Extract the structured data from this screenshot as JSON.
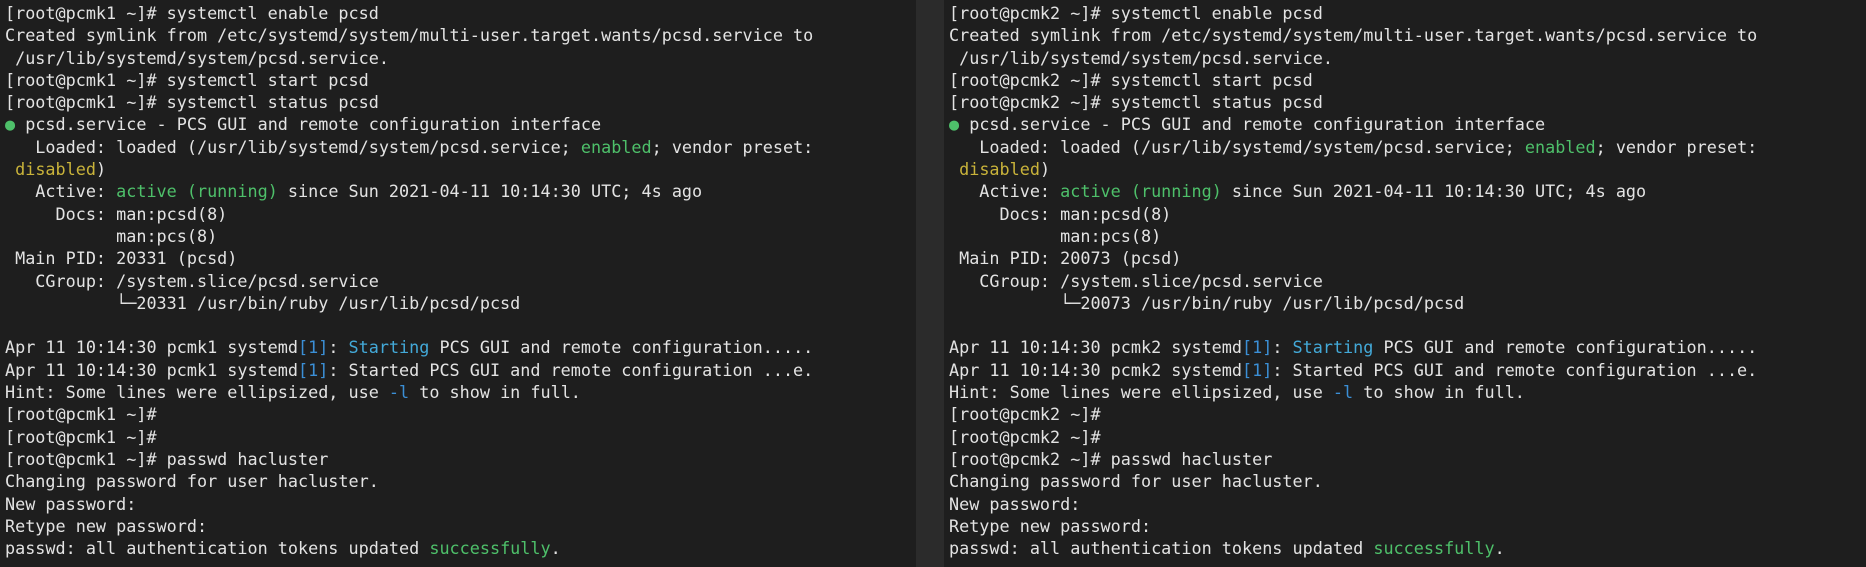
{
  "colors": {
    "background": "#1e1e1e",
    "text": "#e3e3e3",
    "green": "#4ec06a",
    "yellow": "#c9b33a",
    "blue": "#3b8fd6",
    "cyan": "#43a9d8"
  },
  "panes": [
    {
      "host": "pcmk1",
      "lines": [
        [
          {
            "t": "[root@pcmk1 ~]# systemctl enable pcsd"
          }
        ],
        [
          {
            "t": "Created symlink from /etc/systemd/system/multi-user.target.wants/pcsd.service to"
          }
        ],
        [
          {
            "t": " /usr/lib/systemd/system/pcsd.service."
          }
        ],
        [
          {
            "t": "[root@pcmk1 ~]# systemctl start pcsd"
          }
        ],
        [
          {
            "t": "[root@pcmk1 ~]# systemctl status pcsd"
          }
        ],
        [
          {
            "t": "●",
            "c": "dot"
          },
          {
            "t": " pcsd.service - PCS GUI and remote configuration interface"
          }
        ],
        [
          {
            "t": "   Loaded: loaded (/usr/lib/systemd/system/pcsd.service; "
          },
          {
            "t": "enabled",
            "c": "green"
          },
          {
            "t": "; vendor preset:"
          }
        ],
        [
          {
            "t": " "
          },
          {
            "t": "disabled",
            "c": "yellow"
          },
          {
            "t": ")"
          }
        ],
        [
          {
            "t": "   Active: "
          },
          {
            "t": "active (running)",
            "c": "green"
          },
          {
            "t": " since Sun 2021-04-11 10:14:30 UTC; 4s ago"
          }
        ],
        [
          {
            "t": "     Docs: man:pcsd(8)"
          }
        ],
        [
          {
            "t": "           man:pcs(8)"
          }
        ],
        [
          {
            "t": " Main PID: 20331 (pcsd)"
          }
        ],
        [
          {
            "t": "   CGroup: /system.slice/pcsd.service"
          }
        ],
        [
          {
            "t": "           └─20331 /usr/bin/ruby /usr/lib/pcsd/pcsd"
          }
        ],
        [
          {
            "t": ""
          }
        ],
        [
          {
            "t": "Apr 11 10:14:30 pcmk1 systemd"
          },
          {
            "t": "[1]",
            "c": "blue"
          },
          {
            "t": ": "
          },
          {
            "t": "Starting",
            "c": "cyan"
          },
          {
            "t": " PCS GUI and remote configuration....."
          }
        ],
        [
          {
            "t": "Apr 11 10:14:30 pcmk1 systemd"
          },
          {
            "t": "[1]",
            "c": "blue"
          },
          {
            "t": ": Started PCS GUI and remote configuration ...e."
          }
        ],
        [
          {
            "t": "Hint: Some lines were ellipsized, use "
          },
          {
            "t": "-l",
            "c": "blue"
          },
          {
            "t": " to show in full."
          }
        ],
        [
          {
            "t": "[root@pcmk1 ~]#"
          }
        ],
        [
          {
            "t": "[root@pcmk1 ~]#"
          }
        ],
        [
          {
            "t": "[root@pcmk1 ~]# passwd hacluster"
          }
        ],
        [
          {
            "t": "Changing password for user hacluster."
          }
        ],
        [
          {
            "t": "New password:"
          }
        ],
        [
          {
            "t": "Retype new password:"
          }
        ],
        [
          {
            "t": "passwd: all authentication tokens updated "
          },
          {
            "t": "successfully",
            "c": "green"
          },
          {
            "t": "."
          }
        ]
      ]
    },
    {
      "host": "pcmk2",
      "lines": [
        [
          {
            "t": "[root@pcmk2 ~]# systemctl enable pcsd"
          }
        ],
        [
          {
            "t": "Created symlink from /etc/systemd/system/multi-user.target.wants/pcsd.service to"
          }
        ],
        [
          {
            "t": " /usr/lib/systemd/system/pcsd.service."
          }
        ],
        [
          {
            "t": "[root@pcmk2 ~]# systemctl start pcsd"
          }
        ],
        [
          {
            "t": "[root@pcmk2 ~]# systemctl status pcsd"
          }
        ],
        [
          {
            "t": "●",
            "c": "dot"
          },
          {
            "t": " pcsd.service - PCS GUI and remote configuration interface"
          }
        ],
        [
          {
            "t": "   Loaded: loaded (/usr/lib/systemd/system/pcsd.service; "
          },
          {
            "t": "enabled",
            "c": "green"
          },
          {
            "t": "; vendor preset:"
          }
        ],
        [
          {
            "t": " "
          },
          {
            "t": "disabled",
            "c": "yellow"
          },
          {
            "t": ")"
          }
        ],
        [
          {
            "t": "   Active: "
          },
          {
            "t": "active (running)",
            "c": "green"
          },
          {
            "t": " since Sun 2021-04-11 10:14:30 UTC; 4s ago"
          }
        ],
        [
          {
            "t": "     Docs: man:pcsd(8)"
          }
        ],
        [
          {
            "t": "           man:pcs(8)"
          }
        ],
        [
          {
            "t": " Main PID: 20073 (pcsd)"
          }
        ],
        [
          {
            "t": "   CGroup: /system.slice/pcsd.service"
          }
        ],
        [
          {
            "t": "           └─20073 /usr/bin/ruby /usr/lib/pcsd/pcsd"
          }
        ],
        [
          {
            "t": ""
          }
        ],
        [
          {
            "t": "Apr 11 10:14:30 pcmk2 systemd"
          },
          {
            "t": "[1]",
            "c": "blue"
          },
          {
            "t": ": "
          },
          {
            "t": "Starting",
            "c": "cyan"
          },
          {
            "t": " PCS GUI and remote configuration....."
          }
        ],
        [
          {
            "t": "Apr 11 10:14:30 pcmk2 systemd"
          },
          {
            "t": "[1]",
            "c": "blue"
          },
          {
            "t": ": Started PCS GUI and remote configuration ...e."
          }
        ],
        [
          {
            "t": "Hint: Some lines were ellipsized, use "
          },
          {
            "t": "-l",
            "c": "blue"
          },
          {
            "t": " to show in full."
          }
        ],
        [
          {
            "t": "[root@pcmk2 ~]#"
          }
        ],
        [
          {
            "t": "[root@pcmk2 ~]#"
          }
        ],
        [
          {
            "t": "[root@pcmk2 ~]# passwd hacluster"
          }
        ],
        [
          {
            "t": "Changing password for user hacluster."
          }
        ],
        [
          {
            "t": "New password:"
          }
        ],
        [
          {
            "t": "Retype new password:"
          }
        ],
        [
          {
            "t": "passwd: all authentication tokens updated "
          },
          {
            "t": "successfully",
            "c": "green"
          },
          {
            "t": "."
          }
        ]
      ]
    }
  ]
}
